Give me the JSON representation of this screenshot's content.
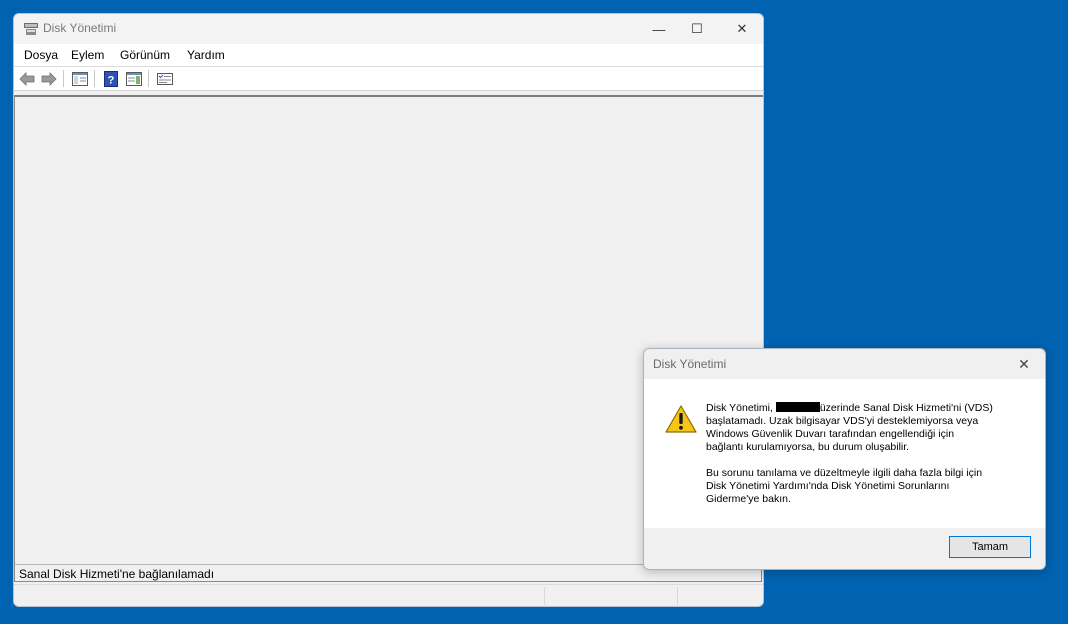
{
  "window": {
    "title": "Disk Yönetimi",
    "controls": {
      "minimize": "—",
      "maximize": "☐",
      "close": "✕"
    }
  },
  "menu": {
    "items": [
      "Dosya",
      "Eylem",
      "Görünüm",
      "Yardım"
    ]
  },
  "toolbar": {
    "icons": [
      "back-icon",
      "forward-icon",
      "show-hide-console-tree-icon",
      "help-icon",
      "show-action-pane-icon",
      "properties-icon"
    ]
  },
  "status": {
    "message": "Sanal Disk Hizmeti'ne bağlanılamadı"
  },
  "dialog": {
    "title": "Disk Yönetimi",
    "close": "✕",
    "icon": "warning-icon",
    "message_part1": "Disk Yönetimi, ",
    "message_part2": "üzerinde Sanal Disk Hizmeti'ni (VDS)\nbaşlatamadı. Uzak bilgisayar VDS'yi desteklemiyorsa veya\nWindows Güvenlik Duvarı tarafından engellendiği için\nbağlantı kurulamıyorsa, bu durum oluşabilir.",
    "message_part3": "Bu sorunu tanılama ve düzeltmeyle ilgili daha fazla bilgi için\nDisk Yönetimi Yardımı'nda Disk Yönetimi Sorunlarını\nGiderme'ye bakın.",
    "ok_label": "Tamam"
  },
  "colors": {
    "desktop": "#0063b1",
    "accent": "#0078d7"
  }
}
